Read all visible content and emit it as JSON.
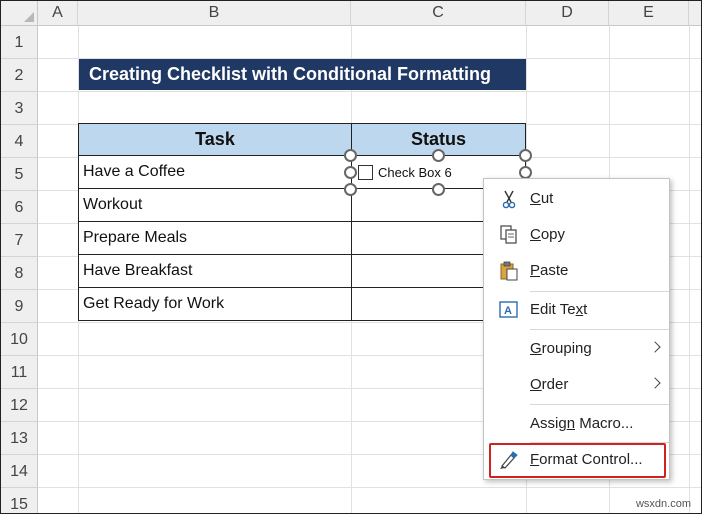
{
  "columns": [
    "A",
    "B",
    "C",
    "D",
    "E"
  ],
  "rows": [
    "1",
    "2",
    "3",
    "4",
    "5",
    "6",
    "7",
    "8",
    "9",
    "10",
    "11",
    "12",
    "13",
    "14",
    "15"
  ],
  "title": "Creating Checklist with Conditional Formatting",
  "table": {
    "headers": [
      "Task",
      "Status"
    ],
    "tasks": [
      "Have a Coffee",
      "Workout",
      "Prepare Meals",
      "Have Breakfast",
      "Get Ready for Work"
    ]
  },
  "checkbox": {
    "label": "Check Box 6"
  },
  "context_menu": {
    "cut": {
      "label_u": "C",
      "label_rest": "ut",
      "icon": "scissors-icon"
    },
    "copy": {
      "label_u": "C",
      "label_rest": "opy",
      "icon": "copy-icon"
    },
    "paste": {
      "label_u": "P",
      "label_rest": "aste",
      "icon": "paste-icon"
    },
    "edit_text": {
      "label_pre": "Edit Te",
      "label_u": "x",
      "label_rest": "t",
      "icon": "edit-text-icon"
    },
    "grouping": {
      "label_u": "G",
      "label_rest": "rouping"
    },
    "order": {
      "label_u": "O",
      "label_rest": "rder"
    },
    "assign_macro": {
      "label_pre": "Assig",
      "label_u": "n",
      "label_rest": " Macro..."
    },
    "format_control": {
      "label_u": "F",
      "label_rest": "ormat Control...",
      "icon": "format-control-icon"
    }
  },
  "watermark": "wsxdn.com",
  "colors": {
    "title_bg": "#1f3864",
    "header_bg": "#bdd7ee",
    "highlight": "#d0231f"
  }
}
